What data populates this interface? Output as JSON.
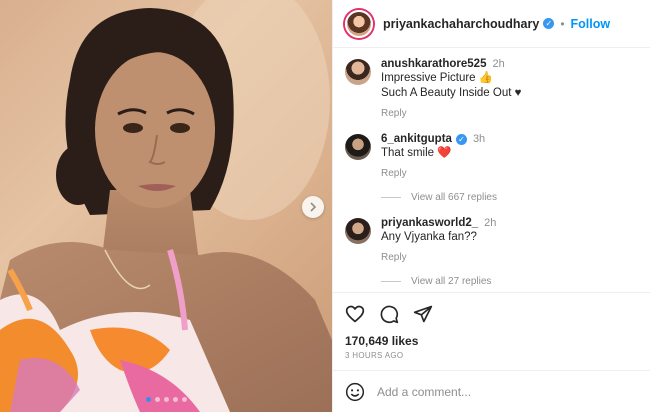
{
  "post": {
    "username": "priyankachaharchoudhary",
    "follow_label": "Follow",
    "separator": "•"
  },
  "comments": [
    {
      "username": "anushkarathore525",
      "time": "2h",
      "lines": [
        "Impressive Picture 👍",
        "Such A Beauty Inside Out ♥"
      ],
      "reply": "Reply"
    },
    {
      "username": "6_ankitgupta",
      "verified": true,
      "time": "3h",
      "lines": [
        "That smile ❤️"
      ],
      "reply": "Reply",
      "view_all": "View all 667 replies"
    },
    {
      "username": "priyankasworld2_",
      "time": "2h",
      "lines": [
        "Any Vjyanka fan??"
      ],
      "reply": "Reply",
      "view_all": "View all 27 replies"
    }
  ],
  "stats": {
    "likes": "170,649 likes",
    "time_ago": "3 HOURS AGO"
  },
  "add_comment": {
    "placeholder": "Add a comment..."
  },
  "icons": [
    "heart-icon",
    "comment-icon",
    "share-icon",
    "emoji-icon",
    "verified-icon",
    "chevron-right-icon"
  ],
  "colors": {
    "link": "#0095f6",
    "verified": "#3897f0",
    "muted": "#8e8e8e",
    "heart": "#ed4956"
  },
  "carousel": {
    "count": 5,
    "active": 0
  }
}
